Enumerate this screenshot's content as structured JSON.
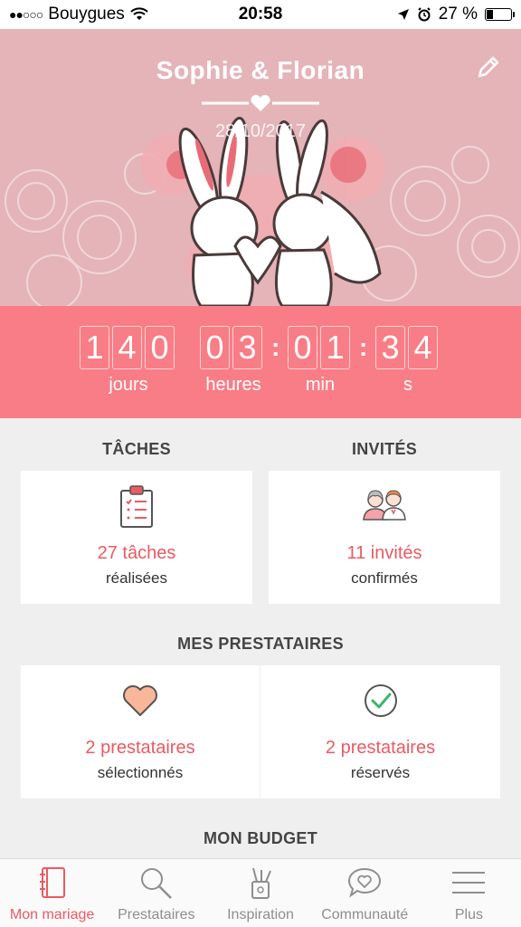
{
  "status_bar": {
    "carrier": "Bouygues",
    "time": "20:58",
    "battery": "27 %",
    "battery_level": 0.27
  },
  "header": {
    "couple": "Sophie & Florian",
    "date": "28/10/2017"
  },
  "countdown": {
    "days_digits": [
      "1",
      "4",
      "0"
    ],
    "hours_digits": [
      "0",
      "3"
    ],
    "minutes_digits": [
      "0",
      "1"
    ],
    "seconds_digits": [
      "3",
      "4"
    ],
    "days_label": "jours",
    "hours_label": "heures",
    "minutes_label": "min",
    "seconds_label": "s"
  },
  "tasks": {
    "title": "TÂCHES",
    "count": "27 tâches",
    "sub": "réalisées"
  },
  "guests": {
    "title": "INVITÉS",
    "count": "11 invités",
    "sub": "confirmés"
  },
  "vendors": {
    "title": "MES PRESTATAIRES",
    "selected_count": "2 prestataires",
    "selected_sub": "sélectionnés",
    "booked_count": "2 prestataires",
    "booked_sub": "réservés"
  },
  "budget": {
    "title": "MON BUDGET"
  },
  "tabbar": {
    "items": [
      {
        "label": "Mon mariage",
        "icon": "notebook-icon",
        "active": true
      },
      {
        "label": "Prestataires",
        "icon": "search-icon",
        "active": false
      },
      {
        "label": "Inspiration",
        "icon": "cup-brushes-icon",
        "active": false
      },
      {
        "label": "Communauté",
        "icon": "chat-heart-icon",
        "active": false
      },
      {
        "label": "Plus",
        "icon": "menu-icon",
        "active": false
      }
    ]
  },
  "colors": {
    "accent": "#f97d86",
    "accent_text": "#ea5a63",
    "hero_bg": "#e5b3b8"
  }
}
